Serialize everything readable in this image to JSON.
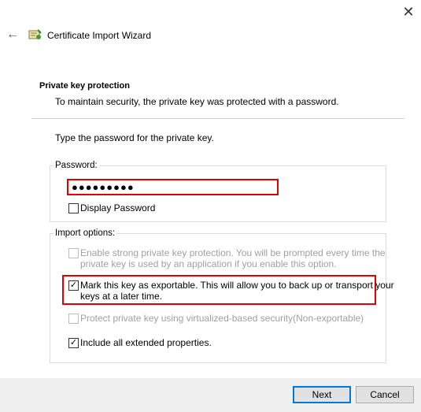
{
  "window": {
    "title": "Certificate Import Wizard",
    "close_glyph": "✕",
    "back_glyph": "←"
  },
  "header": {
    "title": "Private key protection",
    "description": "To maintain security, the private key was protected with a password."
  },
  "body": {
    "instruction": "Type the password for the private key."
  },
  "password_group": {
    "label": "Password:",
    "value": "●●●●●●●●●",
    "display_password": {
      "label": "Display Password",
      "checked": false
    }
  },
  "import_options": {
    "label": "Import options:",
    "strong_protection": {
      "line1": "Enable strong private key protection. You will be prompted every time the",
      "line2": "private key is used by an application if you enable this option.",
      "checked": false,
      "enabled": false
    },
    "exportable": {
      "line1": "Mark this key as exportable. This will allow you to back up or transport your",
      "line2": "keys at a later time.",
      "checked": true,
      "check_glyph": "✓"
    },
    "vbs": {
      "label": "Protect private key using virtualized-based security(Non-exportable)",
      "checked": false,
      "enabled": false
    },
    "extended": {
      "label": "Include all extended properties.",
      "checked": true,
      "check_glyph": "✓"
    }
  },
  "footer": {
    "next_label": "Next",
    "cancel_label": "Cancel"
  },
  "colors": {
    "highlight": "#e00000",
    "primary_button_border": "#0078d7",
    "disabled_text": "#a0a0a0"
  }
}
